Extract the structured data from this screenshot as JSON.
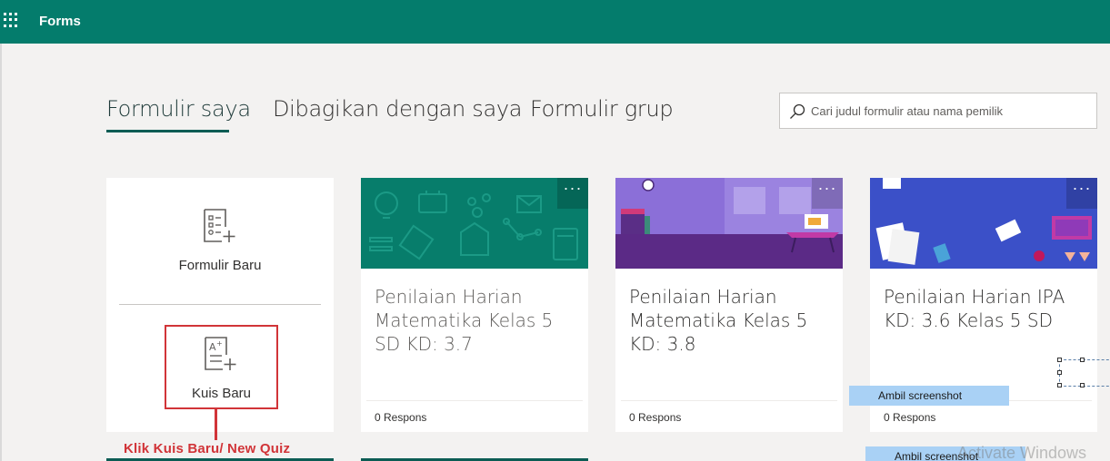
{
  "app": {
    "title": "Forms"
  },
  "tabs": [
    {
      "label": "Formulir saya",
      "active": true
    },
    {
      "label": "Dibagikan dengan saya",
      "active": false
    },
    {
      "label": "Formulir grup",
      "active": false
    }
  ],
  "search": {
    "placeholder": "Cari judul formulir atau nama pemilik",
    "value": ""
  },
  "new_panel": {
    "new_form_label": "Formulir Baru",
    "new_quiz_label": "Kuis Baru",
    "callout": "Klik Kuis Baru/ New Quiz"
  },
  "cards": [
    {
      "title": "Penilaian Harian Matematika Kelas 5 SD KD: 3.7",
      "responses": "0 Respons",
      "more": "···",
      "theme_color": "#077d6b"
    },
    {
      "title": "Penilaian Harian Matematika Kelas 5 KD: 3.8",
      "responses": "0 Respons",
      "more": "···",
      "theme_color": "#8b6fd8"
    },
    {
      "title": "Penilaian Harian IPA KD: 3.6 Kelas 5 SD",
      "responses": "0 Respons",
      "more": "···",
      "theme_color": "#3b50c8"
    }
  ],
  "overlays": {
    "snip_label_1": "Ambil screenshot",
    "snip_label_2": "Ambil screenshot",
    "watermark": "Activate Windows"
  },
  "colors": {
    "brand": "#047c6c",
    "accent_red": "#d13438",
    "snip_blue": "#a9d1f5"
  }
}
